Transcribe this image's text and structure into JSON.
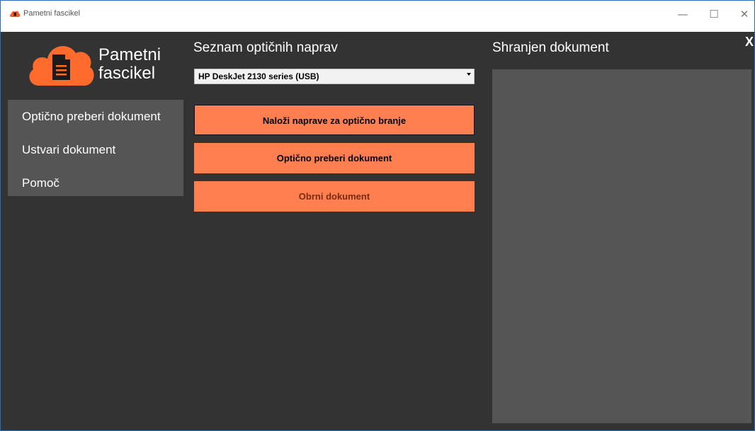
{
  "window": {
    "title": "Pametni fascikel",
    "controls": {
      "minimize": "—",
      "maximize": "☐",
      "close": "✕"
    }
  },
  "brand": {
    "line1": "Pametni",
    "line2": "fascikel",
    "accent_color": "#ff7f50"
  },
  "sidebar": {
    "items": [
      {
        "label": "Optično preberi dokument"
      },
      {
        "label": "Ustvari dokument"
      },
      {
        "label": "Pomoč"
      }
    ]
  },
  "scanner_section": {
    "title": "Seznam optičnih naprav",
    "selected_device": "HP DeskJet 2130 series (USB)"
  },
  "buttons": {
    "load_devices": "Naloži naprave za optično branje",
    "scan_document": "Optično preberi dokument",
    "rotate_document": "Obrni dokument"
  },
  "document_section": {
    "title": "Shranjen dokument",
    "close_label": "X"
  }
}
